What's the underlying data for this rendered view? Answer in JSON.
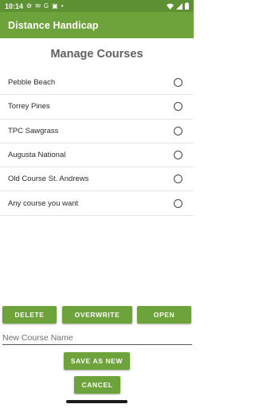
{
  "status_bar": {
    "time": "10:14",
    "left_icons": [
      "settings-icon",
      "gmail-icon",
      "google-icon",
      "mail-icon",
      "dot-icon"
    ],
    "right_icons": [
      "wifi-icon",
      "signal-icon",
      "battery-icon"
    ]
  },
  "app_bar": {
    "title": "Distance Handicap",
    "color": "#6da33a"
  },
  "page": {
    "heading": "Manage Courses"
  },
  "courses": [
    {
      "name": "Pebble Beach",
      "selected": false
    },
    {
      "name": "Torrey Pines",
      "selected": false
    },
    {
      "name": "TPC Sawgrass",
      "selected": false
    },
    {
      "name": "Augusta National",
      "selected": false
    },
    {
      "name": "Old Course St. Andrews",
      "selected": false
    },
    {
      "name": "Any course you want",
      "selected": false
    }
  ],
  "buttons": {
    "delete": "DELETE",
    "overwrite": "OVERWRITE",
    "open": "OPEN",
    "save_as_new": "SAVE AS NEW",
    "cancel": "CANCEL"
  },
  "new_course": {
    "placeholder": "New Course Name",
    "value": ""
  }
}
